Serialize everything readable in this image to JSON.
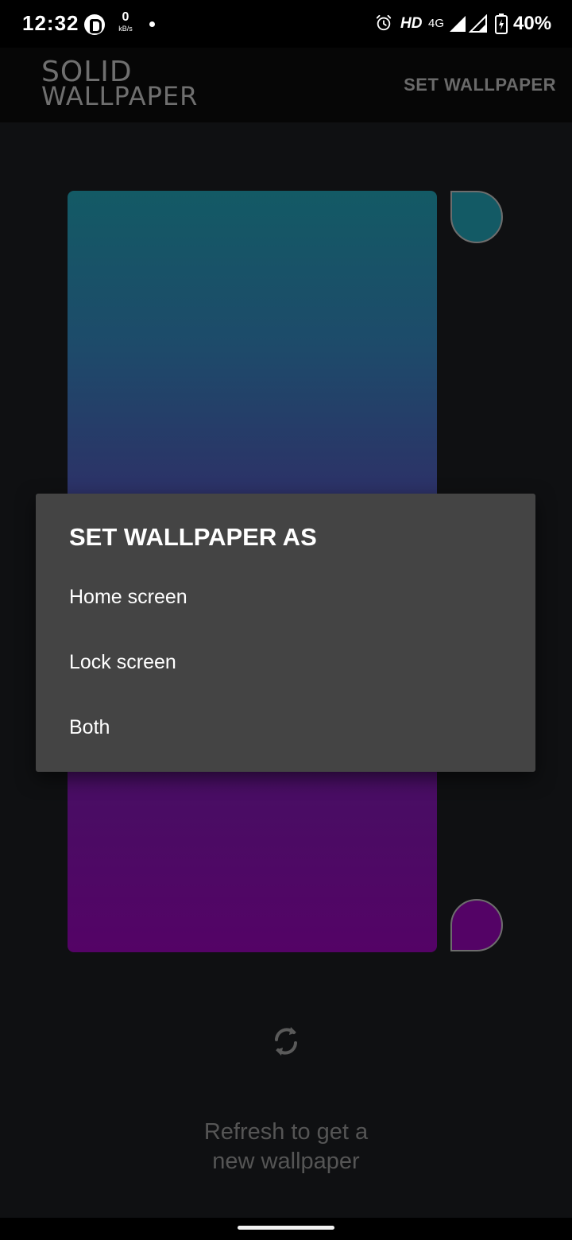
{
  "status_bar": {
    "time": "12:32",
    "net_speed_value": "0",
    "net_speed_unit": "kB/s",
    "hd_label": "HD",
    "network_type": "4G",
    "battery_percent": "40%"
  },
  "app_bar": {
    "logo_line1": "SOLID",
    "logo_line2": "WALLPAPER",
    "action_label": "SET WALLPAPER"
  },
  "preview": {
    "gradient_top_color": "#135a65",
    "gradient_bottom_color": "#540366"
  },
  "dialog": {
    "title": "SET WALLPAPER AS",
    "options": [
      {
        "label": "Home screen"
      },
      {
        "label": "Lock screen"
      },
      {
        "label": "Both"
      }
    ]
  },
  "refresh": {
    "icon": "refresh-icon",
    "hint_line1": "Refresh to get a",
    "hint_line2": "new wallpaper"
  }
}
